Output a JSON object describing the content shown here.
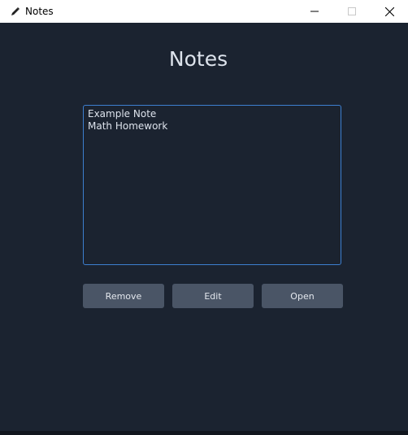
{
  "window": {
    "title": "Notes",
    "icon": "pencil-icon"
  },
  "main": {
    "heading": "Notes",
    "notes": [
      "Example Note",
      "Math Homework"
    ],
    "buttons": {
      "remove": "Remove",
      "edit": "Edit",
      "open": "Open"
    }
  },
  "colors": {
    "background": "#1b2330",
    "list_border": "#3d7fd0",
    "button_bg": "#4a5566",
    "text": "#dde3ec"
  }
}
